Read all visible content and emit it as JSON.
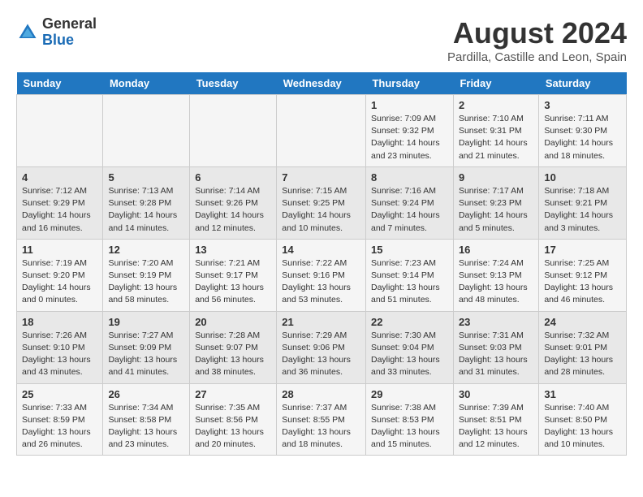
{
  "logo": {
    "general": "General",
    "blue": "Blue"
  },
  "title": {
    "month_year": "August 2024",
    "location": "Pardilla, Castille and Leon, Spain"
  },
  "days_header": [
    "Sunday",
    "Monday",
    "Tuesday",
    "Wednesday",
    "Thursday",
    "Friday",
    "Saturday"
  ],
  "weeks": [
    [
      {
        "day": "",
        "content": ""
      },
      {
        "day": "",
        "content": ""
      },
      {
        "day": "",
        "content": ""
      },
      {
        "day": "",
        "content": ""
      },
      {
        "day": "1",
        "content": "Sunrise: 7:09 AM\nSunset: 9:32 PM\nDaylight: 14 hours\nand 23 minutes."
      },
      {
        "day": "2",
        "content": "Sunrise: 7:10 AM\nSunset: 9:31 PM\nDaylight: 14 hours\nand 21 minutes."
      },
      {
        "day": "3",
        "content": "Sunrise: 7:11 AM\nSunset: 9:30 PM\nDaylight: 14 hours\nand 18 minutes."
      }
    ],
    [
      {
        "day": "4",
        "content": "Sunrise: 7:12 AM\nSunset: 9:29 PM\nDaylight: 14 hours\nand 16 minutes."
      },
      {
        "day": "5",
        "content": "Sunrise: 7:13 AM\nSunset: 9:28 PM\nDaylight: 14 hours\nand 14 minutes."
      },
      {
        "day": "6",
        "content": "Sunrise: 7:14 AM\nSunset: 9:26 PM\nDaylight: 14 hours\nand 12 minutes."
      },
      {
        "day": "7",
        "content": "Sunrise: 7:15 AM\nSunset: 9:25 PM\nDaylight: 14 hours\nand 10 minutes."
      },
      {
        "day": "8",
        "content": "Sunrise: 7:16 AM\nSunset: 9:24 PM\nDaylight: 14 hours\nand 7 minutes."
      },
      {
        "day": "9",
        "content": "Sunrise: 7:17 AM\nSunset: 9:23 PM\nDaylight: 14 hours\nand 5 minutes."
      },
      {
        "day": "10",
        "content": "Sunrise: 7:18 AM\nSunset: 9:21 PM\nDaylight: 14 hours\nand 3 minutes."
      }
    ],
    [
      {
        "day": "11",
        "content": "Sunrise: 7:19 AM\nSunset: 9:20 PM\nDaylight: 14 hours\nand 0 minutes."
      },
      {
        "day": "12",
        "content": "Sunrise: 7:20 AM\nSunset: 9:19 PM\nDaylight: 13 hours\nand 58 minutes."
      },
      {
        "day": "13",
        "content": "Sunrise: 7:21 AM\nSunset: 9:17 PM\nDaylight: 13 hours\nand 56 minutes."
      },
      {
        "day": "14",
        "content": "Sunrise: 7:22 AM\nSunset: 9:16 PM\nDaylight: 13 hours\nand 53 minutes."
      },
      {
        "day": "15",
        "content": "Sunrise: 7:23 AM\nSunset: 9:14 PM\nDaylight: 13 hours\nand 51 minutes."
      },
      {
        "day": "16",
        "content": "Sunrise: 7:24 AM\nSunset: 9:13 PM\nDaylight: 13 hours\nand 48 minutes."
      },
      {
        "day": "17",
        "content": "Sunrise: 7:25 AM\nSunset: 9:12 PM\nDaylight: 13 hours\nand 46 minutes."
      }
    ],
    [
      {
        "day": "18",
        "content": "Sunrise: 7:26 AM\nSunset: 9:10 PM\nDaylight: 13 hours\nand 43 minutes."
      },
      {
        "day": "19",
        "content": "Sunrise: 7:27 AM\nSunset: 9:09 PM\nDaylight: 13 hours\nand 41 minutes."
      },
      {
        "day": "20",
        "content": "Sunrise: 7:28 AM\nSunset: 9:07 PM\nDaylight: 13 hours\nand 38 minutes."
      },
      {
        "day": "21",
        "content": "Sunrise: 7:29 AM\nSunset: 9:06 PM\nDaylight: 13 hours\nand 36 minutes."
      },
      {
        "day": "22",
        "content": "Sunrise: 7:30 AM\nSunset: 9:04 PM\nDaylight: 13 hours\nand 33 minutes."
      },
      {
        "day": "23",
        "content": "Sunrise: 7:31 AM\nSunset: 9:03 PM\nDaylight: 13 hours\nand 31 minutes."
      },
      {
        "day": "24",
        "content": "Sunrise: 7:32 AM\nSunset: 9:01 PM\nDaylight: 13 hours\nand 28 minutes."
      }
    ],
    [
      {
        "day": "25",
        "content": "Sunrise: 7:33 AM\nSunset: 8:59 PM\nDaylight: 13 hours\nand 26 minutes."
      },
      {
        "day": "26",
        "content": "Sunrise: 7:34 AM\nSunset: 8:58 PM\nDaylight: 13 hours\nand 23 minutes."
      },
      {
        "day": "27",
        "content": "Sunrise: 7:35 AM\nSunset: 8:56 PM\nDaylight: 13 hours\nand 20 minutes."
      },
      {
        "day": "28",
        "content": "Sunrise: 7:37 AM\nSunset: 8:55 PM\nDaylight: 13 hours\nand 18 minutes."
      },
      {
        "day": "29",
        "content": "Sunrise: 7:38 AM\nSunset: 8:53 PM\nDaylight: 13 hours\nand 15 minutes."
      },
      {
        "day": "30",
        "content": "Sunrise: 7:39 AM\nSunset: 8:51 PM\nDaylight: 13 hours\nand 12 minutes."
      },
      {
        "day": "31",
        "content": "Sunrise: 7:40 AM\nSunset: 8:50 PM\nDaylight: 13 hours\nand 10 minutes."
      }
    ]
  ]
}
